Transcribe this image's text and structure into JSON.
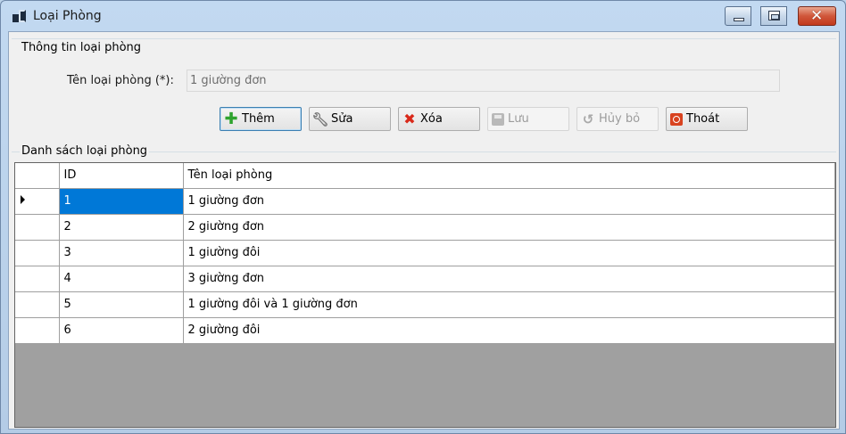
{
  "window": {
    "title": "Loại Phòng"
  },
  "info_group": {
    "title": "Thông tin loại phòng",
    "field_label": "Tên loại phòng (*):",
    "field_value": "1 giường đơn"
  },
  "toolbar": {
    "buttons": [
      {
        "label": "Thêm",
        "icon": "add-icon",
        "enabled": true,
        "focused": true
      },
      {
        "label": "Sửa",
        "icon": "wrench-icon",
        "enabled": true
      },
      {
        "label": "Xóa",
        "icon": "delete-icon",
        "enabled": true
      },
      {
        "label": "Lưu",
        "icon": "save-icon",
        "enabled": false
      },
      {
        "label": "Hủy bỏ",
        "icon": "undo-icon",
        "enabled": false
      },
      {
        "label": "Thoát",
        "icon": "exit-icon",
        "enabled": true
      }
    ]
  },
  "list_group": {
    "title": "Danh sách loại phòng"
  },
  "grid": {
    "columns": [
      "ID",
      "Tên loại phòng"
    ],
    "rows": [
      {
        "id": "1",
        "name": "1 giường đơn",
        "current": true
      },
      {
        "id": "2",
        "name": "2 giường đơn"
      },
      {
        "id": "3",
        "name": "1 giường đôi"
      },
      {
        "id": "4",
        "name": "3 giường đơn"
      },
      {
        "id": "5",
        "name": "1 giường đôi và 1 giường đơn"
      },
      {
        "id": "6",
        "name": "2 giường đôi"
      }
    ]
  },
  "colors": {
    "selection": "#0078d7",
    "grid_background": "#a0a0a0",
    "client_background": "#f0f0f0"
  }
}
